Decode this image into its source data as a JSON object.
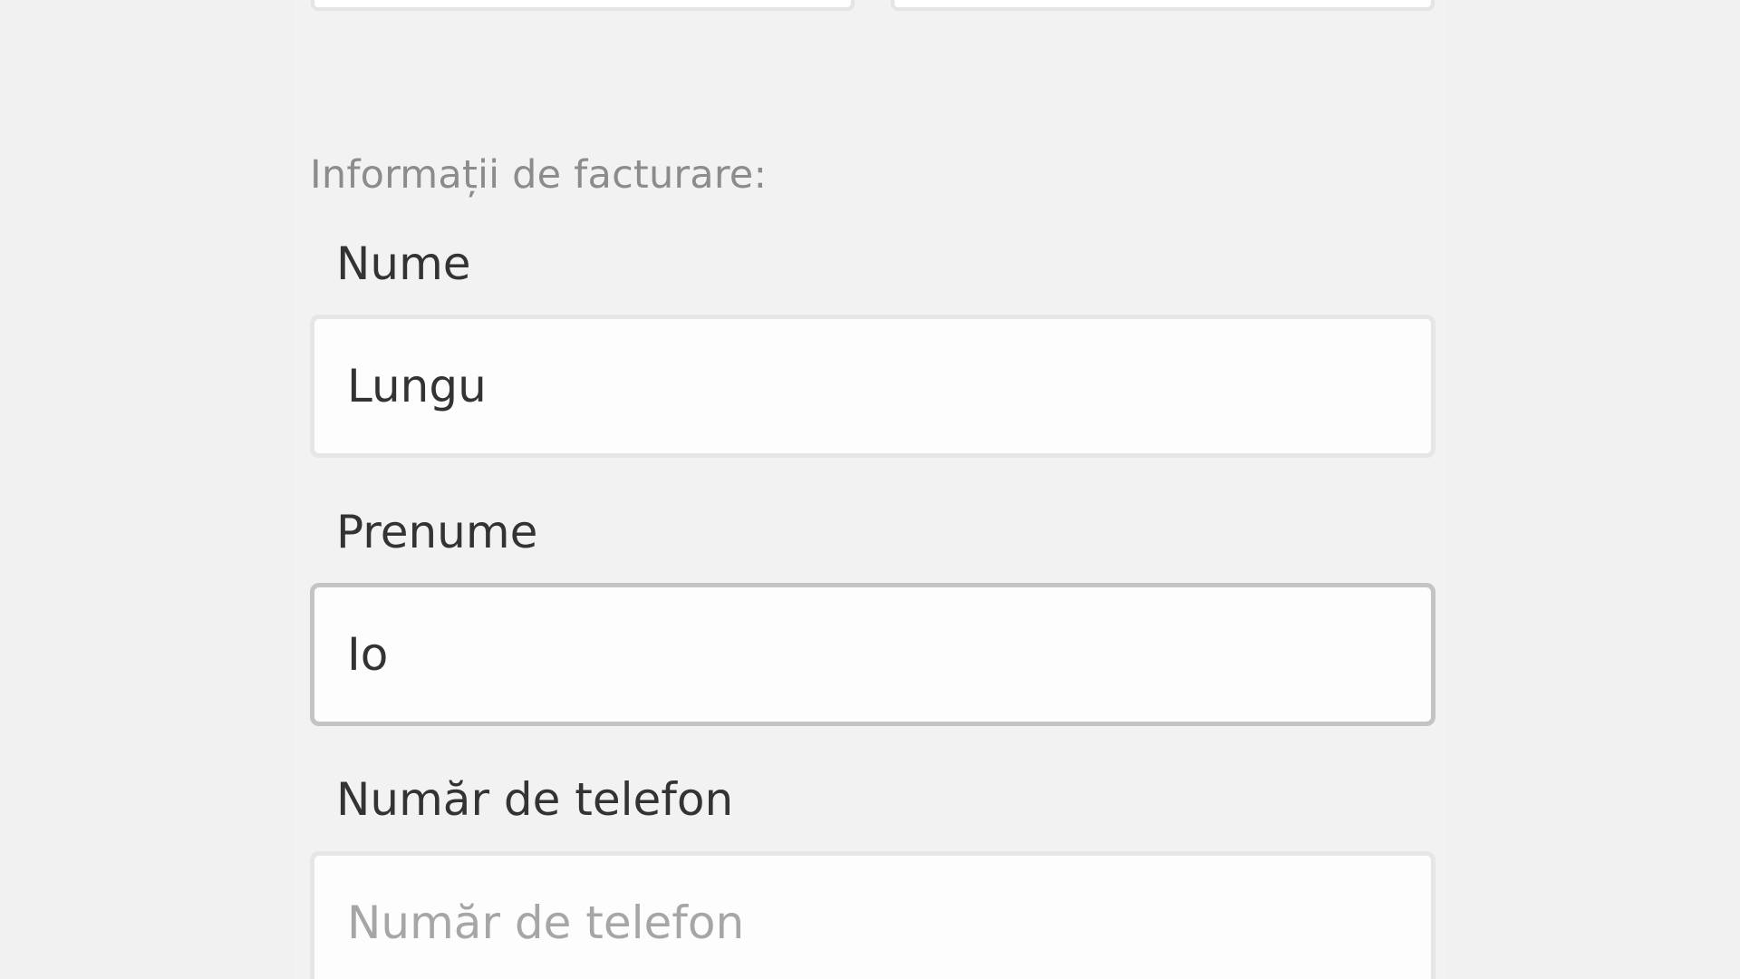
{
  "billing": {
    "section_title": "Informații de facturare:",
    "fields": {
      "last_name": {
        "label": "Nume",
        "value": "Lungu",
        "placeholder": ""
      },
      "first_name": {
        "label": "Prenume",
        "value": "Io",
        "placeholder": "",
        "focused": true
      },
      "phone": {
        "label": "Număr de telefon",
        "value": "",
        "placeholder": "Număr de telefon"
      }
    }
  },
  "colors": {
    "page_background": "#f1f1f1",
    "input_background": "#fdfdfd",
    "input_border": "#e6e6e6",
    "input_border_focused": "#c4c4c4",
    "label_text": "#333333",
    "section_title_text": "#8c8c8c",
    "placeholder_text": "#a6a6a6"
  }
}
